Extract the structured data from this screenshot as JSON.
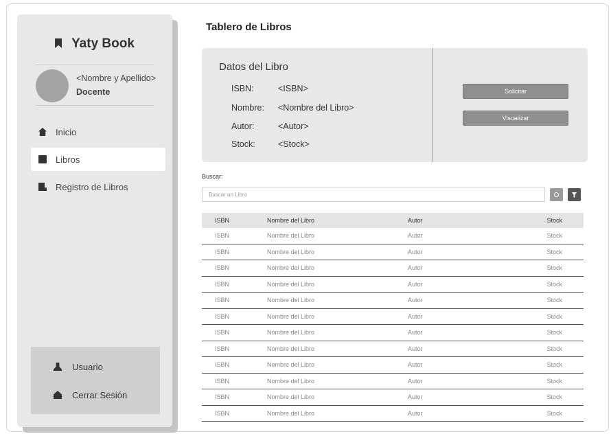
{
  "sidebar": {
    "brand": "Yaty Book",
    "user_name": "<Nombre y Apellido>",
    "user_role": "Docente",
    "nav": [
      {
        "label": "Inicio",
        "icon": "home-icon",
        "active": false
      },
      {
        "label": "Libros",
        "icon": "book-icon",
        "active": true
      },
      {
        "label": "Registro de Libros",
        "icon": "register-icon",
        "active": false
      }
    ],
    "bottom": [
      {
        "label": "Usuario",
        "icon": "user-icon"
      },
      {
        "label": "Cerrar Sesión",
        "icon": "logout-icon"
      }
    ]
  },
  "main": {
    "title": "Tablero de Libros",
    "detail": {
      "title": "Datos del Libro",
      "fields": [
        {
          "label": "ISBN:",
          "value": "<ISBN>"
        },
        {
          "label": "Nombre:",
          "value": "<Nombre del Libro>"
        },
        {
          "label": "Autor:",
          "value": "<Autor>"
        },
        {
          "label": "Stock:",
          "value": "<Stock>"
        }
      ],
      "buttons": {
        "request": "Solicitar",
        "view": "Visualizar"
      }
    },
    "search": {
      "label": "Buscar:",
      "placeholder": "Buscar un Libro"
    },
    "table": {
      "headers": [
        "ISBN",
        "Nombre del Libro",
        "Autor",
        "Stock"
      ],
      "rows": [
        [
          "ISBN",
          "Nombre del Libro",
          "Autor",
          "Stock"
        ],
        [
          "ISBN",
          "Nombre del Libro",
          "Autor",
          "Stock"
        ],
        [
          "ISBN",
          "Nombre del Libro",
          "Autor",
          "Stock"
        ],
        [
          "ISBN",
          "Nombre del Libro",
          "Autor",
          "Stock"
        ],
        [
          "ISBN",
          "Nombre del Libro",
          "Autor",
          "Stock"
        ],
        [
          "ISBN",
          "Nombre del Libro",
          "Autor",
          "Stock"
        ],
        [
          "ISBN",
          "Nombre del Libro",
          "Autor",
          "Stock"
        ],
        [
          "ISBN",
          "Nombre del Libro",
          "Autor",
          "Stock"
        ],
        [
          "ISBN",
          "Nombre del Libro",
          "Autor",
          "Stock"
        ],
        [
          "ISBN",
          "Nombre del Libro",
          "Autor",
          "Stock"
        ],
        [
          "ISBN",
          "Nombre del Libro",
          "Autor",
          "Stock"
        ],
        [
          "ISBN",
          "Nombre del Libro",
          "Autor",
          "Stock"
        ]
      ]
    }
  }
}
